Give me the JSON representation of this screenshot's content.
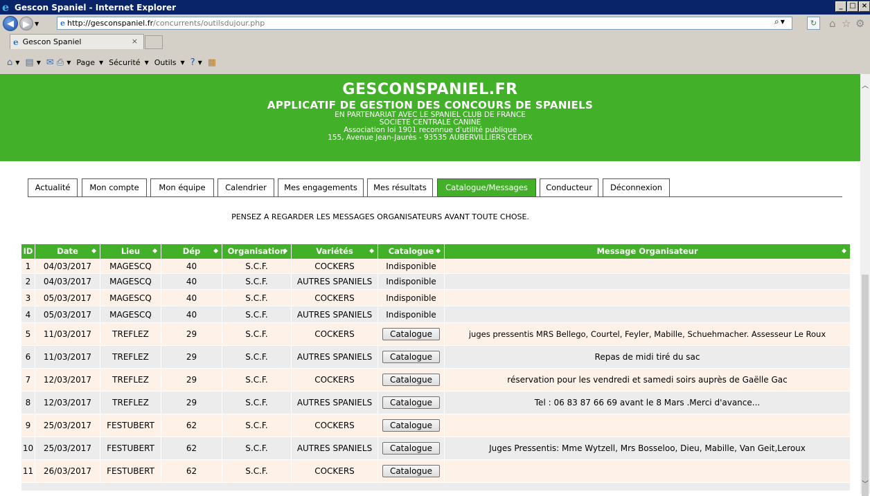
{
  "window": {
    "title": "Gescon Spaniel - Internet Explorer",
    "minimize": "_",
    "maximize": "□",
    "close": "×"
  },
  "address": {
    "url_host": "http://gesconspaniel.fr",
    "url_path": "/concurrents/outilsdujour.php"
  },
  "tabs": [
    {
      "label": "Gescon Spaniel"
    }
  ],
  "commandbar": {
    "page": "Page",
    "security": "Sécurité",
    "tools": "Outils"
  },
  "banner": {
    "title": "GESCONSPANIEL.FR",
    "subtitle": "APPLICATIF DE GESTION DES CONCOURS DE SPANIELS",
    "line1": "EN PARTENARIAT AVEC LE SPANIEL CLUB DE FRANCE",
    "line2": "SOCIETE CENTRALE CANINE",
    "line3": "Association loi 1901 reconnue d'utilité publique",
    "line4": "155, Avenue Jean-Jaurès - 93535 AUBERVILLIERS CEDEX"
  },
  "menu": [
    {
      "label": "Actualité"
    },
    {
      "label": "Mon compte"
    },
    {
      "label": "Mon équipe"
    },
    {
      "label": "Calendrier"
    },
    {
      "label": "Mes engagements"
    },
    {
      "label": "Mes résultats"
    },
    {
      "label": "Catalogue/Messages",
      "active": true
    },
    {
      "label": "Conducteur"
    },
    {
      "label": "Déconnexion"
    }
  ],
  "notice": "PENSEZ A REGARDER LES MESSAGES ORGANISATEURS AVANT TOUTE CHOSE.",
  "table": {
    "headers": [
      "ID",
      "Date",
      "Lieu",
      "Dép",
      "Organisation",
      "Variétés",
      "Catalogue",
      "Message Organisateur"
    ],
    "rows": [
      {
        "id": "1",
        "date": "04/03/2017",
        "lieu": "MAGESCQ",
        "dep": "40",
        "org": "S.C.F.",
        "variete": "COCKERS",
        "catalogue": "Indisponible",
        "button": false,
        "message": ""
      },
      {
        "id": "2",
        "date": "04/03/2017",
        "lieu": "MAGESCQ",
        "dep": "40",
        "org": "S.C.F.",
        "variete": "AUTRES SPANIELS",
        "catalogue": "Indisponible",
        "button": false,
        "message": ""
      },
      {
        "id": "3",
        "date": "05/03/2017",
        "lieu": "MAGESCQ",
        "dep": "40",
        "org": "S.C.F.",
        "variete": "COCKERS",
        "catalogue": "Indisponible",
        "button": false,
        "message": ""
      },
      {
        "id": "4",
        "date": "05/03/2017",
        "lieu": "MAGESCQ",
        "dep": "40",
        "org": "S.C.F.",
        "variete": "AUTRES SPANIELS",
        "catalogue": "Indisponible",
        "button": false,
        "message": ""
      },
      {
        "id": "5",
        "date": "11/03/2017",
        "lieu": "TREFLEZ",
        "dep": "29",
        "org": "S.C.F.",
        "variete": "COCKERS",
        "catalogue": "Catalogue",
        "button": true,
        "message": "juges pressentis MRS Bellego, Courtel, Feyler, Mabille, Schuehmacher. Assesseur Le Roux"
      },
      {
        "id": "6",
        "date": "11/03/2017",
        "lieu": "TREFLEZ",
        "dep": "29",
        "org": "S.C.F.",
        "variete": "AUTRES SPANIELS",
        "catalogue": "Catalogue",
        "button": true,
        "message": "Repas de midi tiré du sac"
      },
      {
        "id": "7",
        "date": "12/03/2017",
        "lieu": "TREFLEZ",
        "dep": "29",
        "org": "S.C.F.",
        "variete": "COCKERS",
        "catalogue": "Catalogue",
        "button": true,
        "message": "réservation pour les vendredi et samedi soirs auprès de Gaëlle Gac"
      },
      {
        "id": "8",
        "date": "12/03/2017",
        "lieu": "TREFLEZ",
        "dep": "29",
        "org": "S.C.F.",
        "variete": "AUTRES SPANIELS",
        "catalogue": "Catalogue",
        "button": true,
        "message": "Tel : 06 83 87 66 69 avant le 8 Mars .Merci d'avance..."
      },
      {
        "id": "9",
        "date": "25/03/2017",
        "lieu": "FESTUBERT",
        "dep": "62",
        "org": "S.C.F.",
        "variete": "COCKERS",
        "catalogue": "Catalogue",
        "button": true,
        "message": ""
      },
      {
        "id": "10",
        "date": "25/03/2017",
        "lieu": "FESTUBERT",
        "dep": "62",
        "org": "S.C.F.",
        "variete": "AUTRES SPANIELS",
        "catalogue": "Catalogue",
        "button": true,
        "message": "Juges Pressentis: Mme Wytzell, Mrs Bosseloo, Dieu, Mabille, Van Geit,Leroux"
      },
      {
        "id": "11",
        "date": "26/03/2017",
        "lieu": "FESTUBERT",
        "dep": "62",
        "org": "S.C.F.",
        "variete": "COCKERS",
        "catalogue": "Catalogue",
        "button": true,
        "message": ""
      }
    ]
  },
  "colors": {
    "brand_green": "#43b02a",
    "row_odd": "#fdf1e8",
    "row_even": "#ececec",
    "titlebar": "#0a246a"
  }
}
